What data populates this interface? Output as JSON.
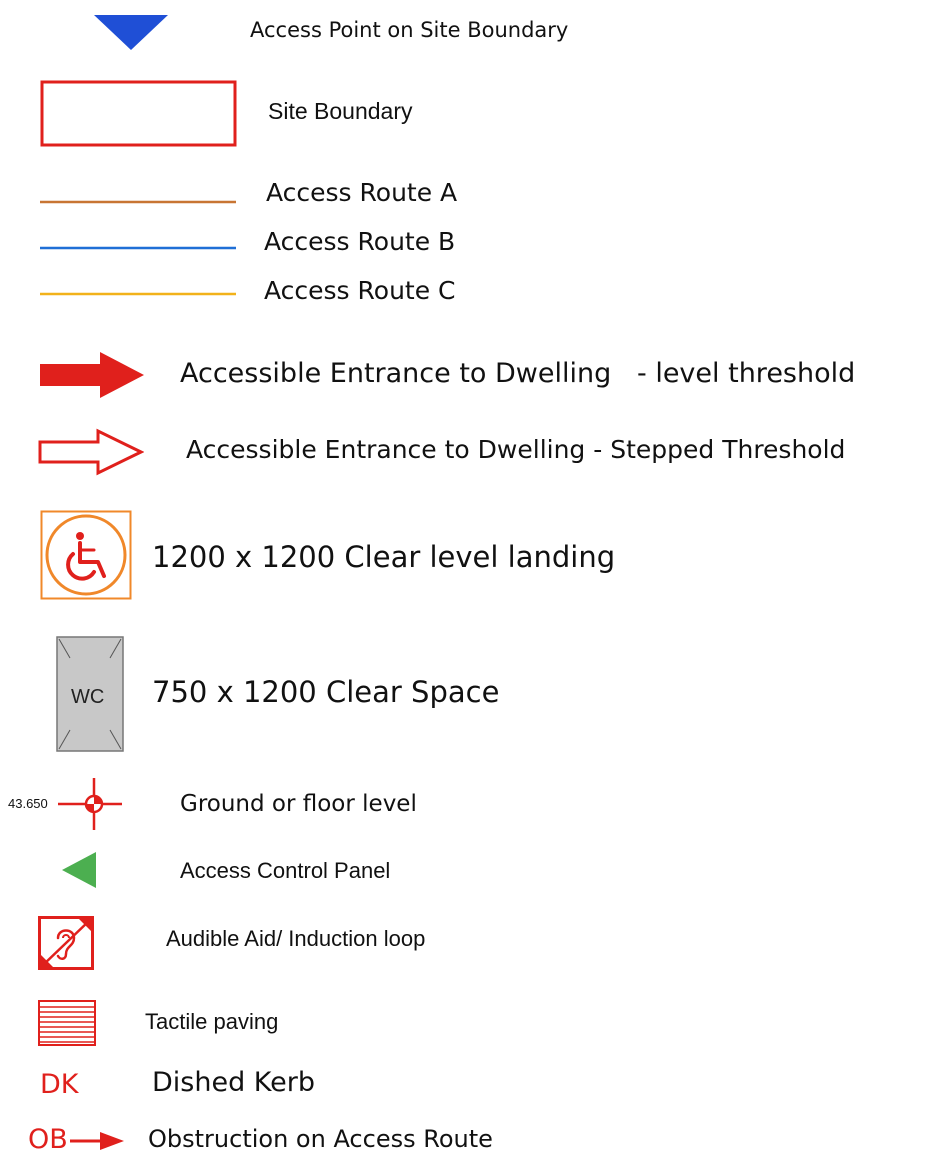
{
  "legend": {
    "access_point": "Access Point on Site Boundary",
    "site_boundary": "Site Boundary",
    "route_a": "Access Route A",
    "route_b": "Access Route B",
    "route_c": "Access Route C",
    "entrance_level": "Accessible Entrance to Dwelling   - level threshold",
    "entrance_stepped": "Accessible Entrance to Dwelling - Stepped Threshold",
    "landing": "1200 x 1200  Clear level landing",
    "clear_space": "750 x 1200  Clear Space",
    "wc_text": "WC",
    "floor_level": "Ground or floor level",
    "floor_level_value": "43.650",
    "control_panel": "Access Control Panel",
    "audible_aid": "Audible Aid/ Induction loop",
    "tactile": "Tactile paving",
    "dk_symbol": "DK",
    "dished_kerb": "Dished Kerb",
    "ob_symbol": "OB",
    "obstruction": "Obstruction on Access Route"
  },
  "colors": {
    "red": "#e0201c",
    "blue_triangle": "#1f4fd6",
    "route_a": "#c87533",
    "route_b": "#1f6fd6",
    "route_c": "#f2b21a",
    "orange": "#f0882a",
    "wc_grey": "#c8c8c8",
    "green": "#4caf50"
  },
  "icons": [
    "access-point-triangle-icon",
    "site-boundary-rect-icon",
    "route-line-icon",
    "solid-arrow-icon",
    "outline-arrow-icon",
    "wheelchair-icon",
    "wc-clear-space-icon",
    "level-marker-icon",
    "control-panel-triangle-icon",
    "hearing-loop-icon",
    "tactile-paving-icon",
    "dk-text-icon",
    "ob-arrow-icon"
  ]
}
